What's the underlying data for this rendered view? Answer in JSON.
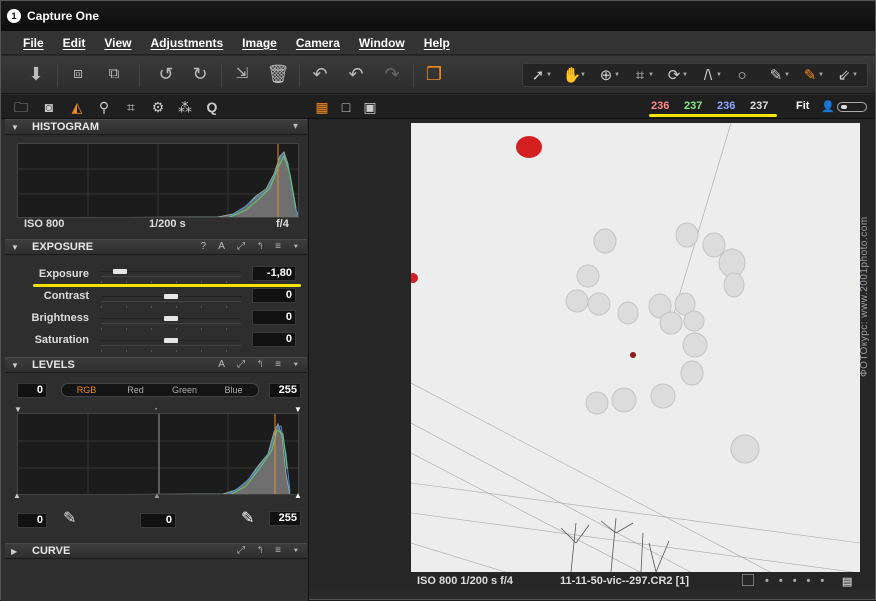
{
  "window": {
    "title": "Capture One"
  },
  "menu": [
    "File",
    "Edit",
    "View",
    "Adjustments",
    "Image",
    "Camera",
    "Window",
    "Help"
  ],
  "toolbar": {
    "icons": [
      "import-icon",
      "compare-left-icon",
      "compare-right-icon",
      "rotate-left-icon",
      "rotate-right-icon",
      "move-to-icon",
      "trash-icon",
      "undo-icon",
      "undo-step-icon",
      "redo-icon",
      "stack-icon"
    ],
    "cursor_tools": [
      "select-tool",
      "pan-tool",
      "zoom-tool",
      "crop-tool",
      "rotate-tool",
      "keystone-tool",
      "spot-tool",
      "brush-tool",
      "color-picker-tool",
      "white-balance-tool"
    ]
  },
  "tool_tabs": [
    "library-tab",
    "capture-tab",
    "exposure-tab",
    "focus-tab",
    "composition-tab",
    "details-tab",
    "adjustments-tab",
    "quick-tab"
  ],
  "tool_tab_glyphs": {
    "focus": "Q"
  },
  "readout": {
    "r": "236",
    "g": "237",
    "b": "236",
    "l": "237",
    "fit": "Fit"
  },
  "colors": {
    "accent": "#f08a22",
    "highlight": "#f3e500",
    "r": "#ff8b8b",
    "g": "#86e886",
    "b": "#8fa6ff"
  },
  "histogram": {
    "title": "HISTOGRAM",
    "iso": "ISO 800",
    "shutter": "1/200 s",
    "aperture": "f/4"
  },
  "exposure": {
    "title": "EXPOSURE",
    "controls": "? A ⤢ ↰ ≡ ▾",
    "sliders": [
      {
        "label": "Exposure",
        "value": "-1,80",
        "level": 0.05
      },
      {
        "label": "Contrast",
        "value": "0",
        "level": 0.5
      },
      {
        "label": "Brightness",
        "value": "0",
        "level": 0.5
      },
      {
        "label": "Saturation",
        "value": "0",
        "level": 0.5
      }
    ]
  },
  "levels": {
    "title": "LEVELS",
    "controls": "A ⤢ ↰ ≡ ▾",
    "input_min": "0",
    "input_max": "255",
    "channels": [
      "RGB",
      "Red",
      "Green",
      "Blue"
    ],
    "active_channel": "RGB",
    "output_min": "0",
    "output_mid": "0",
    "output_max": "255"
  },
  "curve": {
    "title": "CURVE",
    "controls": "⤢ ↰ ≡ ▾"
  },
  "status": {
    "exif": "ISO 800  1/200 s  f/4",
    "filename": "11-11-50-vic--297.CR2 [1]"
  },
  "watermark": "ФОТОкурс: www.2001photo.com"
}
